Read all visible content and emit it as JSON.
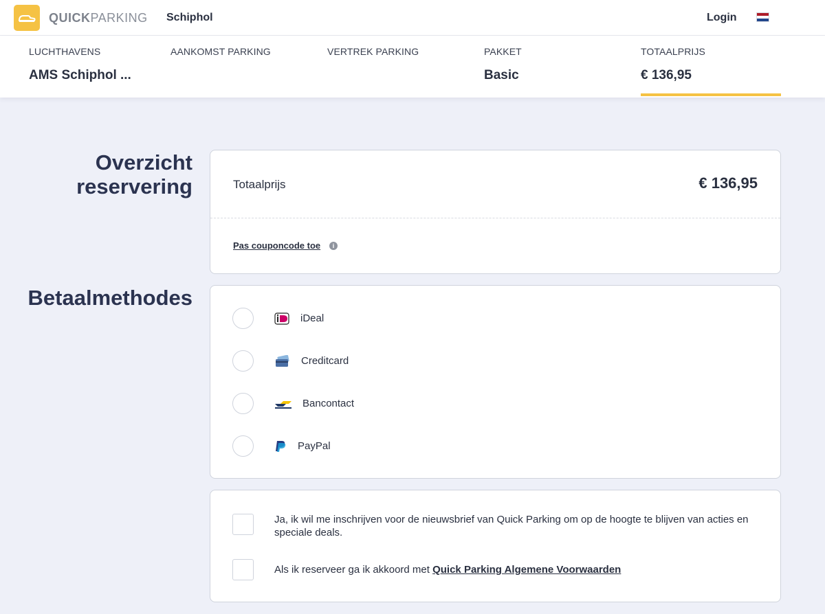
{
  "header": {
    "logo_bold": "QUICK",
    "logo_light": "PARKING",
    "location": "Schiphol",
    "login_label": "Login",
    "flag_colors": [
      "#ae1c28",
      "#ffffff",
      "#21468b"
    ]
  },
  "summary": {
    "columns": [
      {
        "label": "LUCHTHAVENS",
        "value": "AMS Schiphol ..."
      },
      {
        "label": "AANKOMST PARKING",
        "value": ""
      },
      {
        "label": "VERTREK PARKING",
        "value": ""
      },
      {
        "label": "PAKKET",
        "value": "Basic"
      },
      {
        "label": "TOTAALPRIJS",
        "value": "€ 136,95"
      }
    ],
    "accent_color": "#f5c244"
  },
  "overview": {
    "heading": "Overzicht reservering",
    "total_label": "Totaalprijs",
    "total_value": "€ 136,95",
    "coupon_link": "Pas couponcode toe",
    "info_icon": "info-icon"
  },
  "payment": {
    "heading": "Betaalmethodes",
    "methods": [
      {
        "label": "iDeal",
        "icon": "ideal-icon"
      },
      {
        "label": "Creditcard",
        "icon": "creditcard-icon"
      },
      {
        "label": "Bancontact",
        "icon": "bancontact-icon"
      },
      {
        "label": "PayPal",
        "icon": "paypal-icon"
      }
    ]
  },
  "consents": {
    "newsletter": "Ja, ik wil me inschrijven voor de nieuwsbrief van Quick Parking om op de hoogte te blijven van acties en speciale deals.",
    "terms_prefix": "Als ik reserveer ga ik akkoord met ",
    "terms_link": "Quick Parking Algemene Voorwaarden"
  }
}
